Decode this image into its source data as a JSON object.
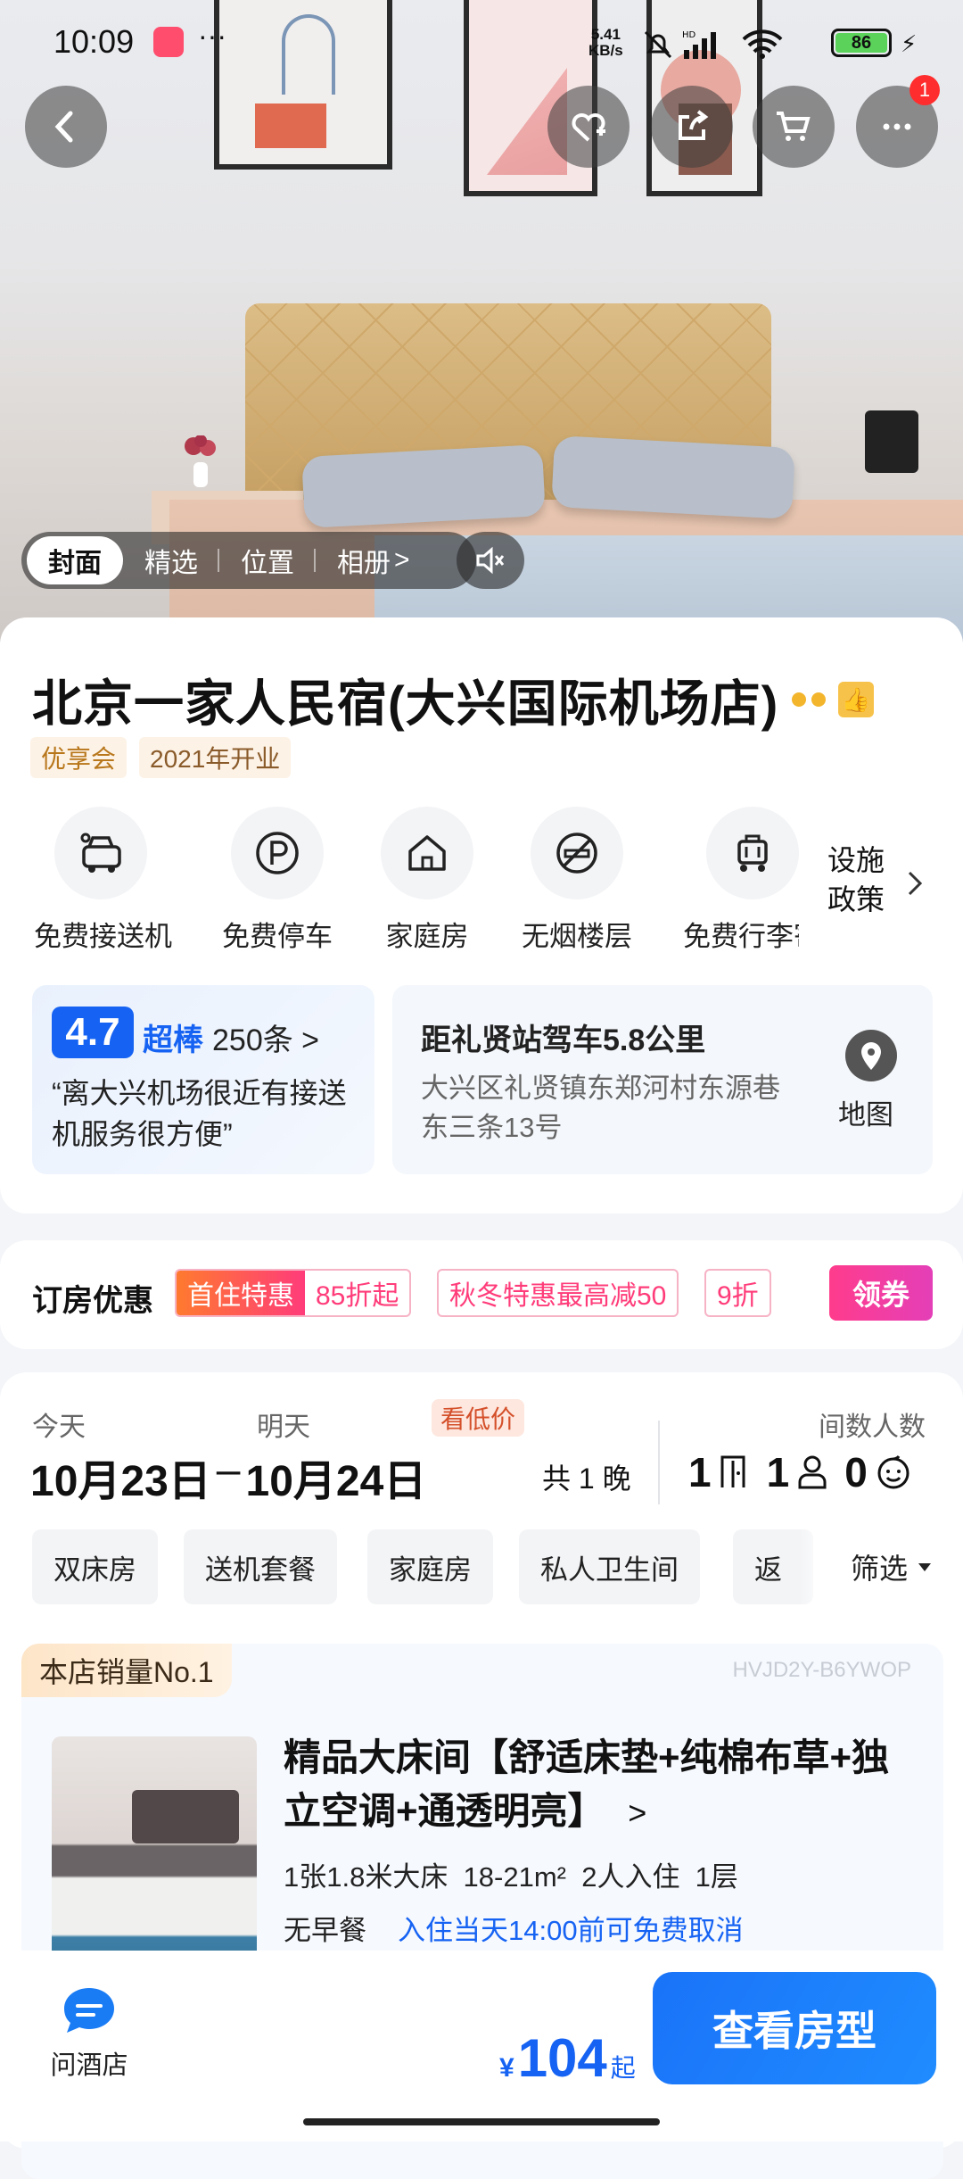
{
  "status": {
    "time": "10:09",
    "net_speed": "5.41",
    "net_unit": "KB/s",
    "battery": "86"
  },
  "hero": {
    "cart_badge": "1",
    "tabs": [
      "封面",
      "精选",
      "位置",
      "相册"
    ],
    "tab_arrow": ">"
  },
  "hotel": {
    "name": "北京一家人民宿(大兴国际机场店)",
    "tags": [
      "优享会",
      "2021年开业"
    ],
    "amenities": [
      "免费接送机",
      "免费停车",
      "家庭房",
      "无烟楼层",
      "免费行李寄"
    ],
    "facilities_label": "设施政策"
  },
  "rating": {
    "score": "4.7",
    "level": "超棒",
    "count": "250条 >",
    "quote": "“离大兴机场很近有接送机服务很方便”"
  },
  "location": {
    "distance": "距礼贤站驾车5.8公里",
    "address": "大兴区礼贤镇东郑河村东源巷东三条13号",
    "map_label": "地图"
  },
  "promo": {
    "label": "订房优惠",
    "first_tag": "首住特惠",
    "first_value": "85折起",
    "autumn": "秋冬特惠最高减50",
    "discount": "9折",
    "coupon_btn": "领券"
  },
  "dates": {
    "today_label": "今天",
    "tomorrow_label": "明天",
    "low_price": "看低价",
    "checkin": "10月23日",
    "dash": "–",
    "checkout": "10月24日",
    "nights": "共 1 晚",
    "guests_label": "间数人数",
    "rooms": "1",
    "adults": "1",
    "children": "0"
  },
  "filters": {
    "chips": [
      "双床房",
      "送机套餐",
      "家庭房",
      "私人卫生间",
      "返"
    ],
    "filter_label": "筛选"
  },
  "room": {
    "ribbon": "本店销量No.1",
    "code": "HVJD2Y-B6YWOP",
    "name": "精品大床间【舒适床垫+纯棉布草+独立空调+通透明亮】",
    "name_arrow": ">",
    "specs": "1张1.8米大床  18-21m²  2人入住  1层",
    "breakfast": "无早餐",
    "cancel": "入住当天14:00前可免费取消"
  },
  "bottom": {
    "ask_label": "问酒店",
    "currency": "¥",
    "price": "104",
    "price_suffix": "起",
    "cta": "查看房型"
  }
}
